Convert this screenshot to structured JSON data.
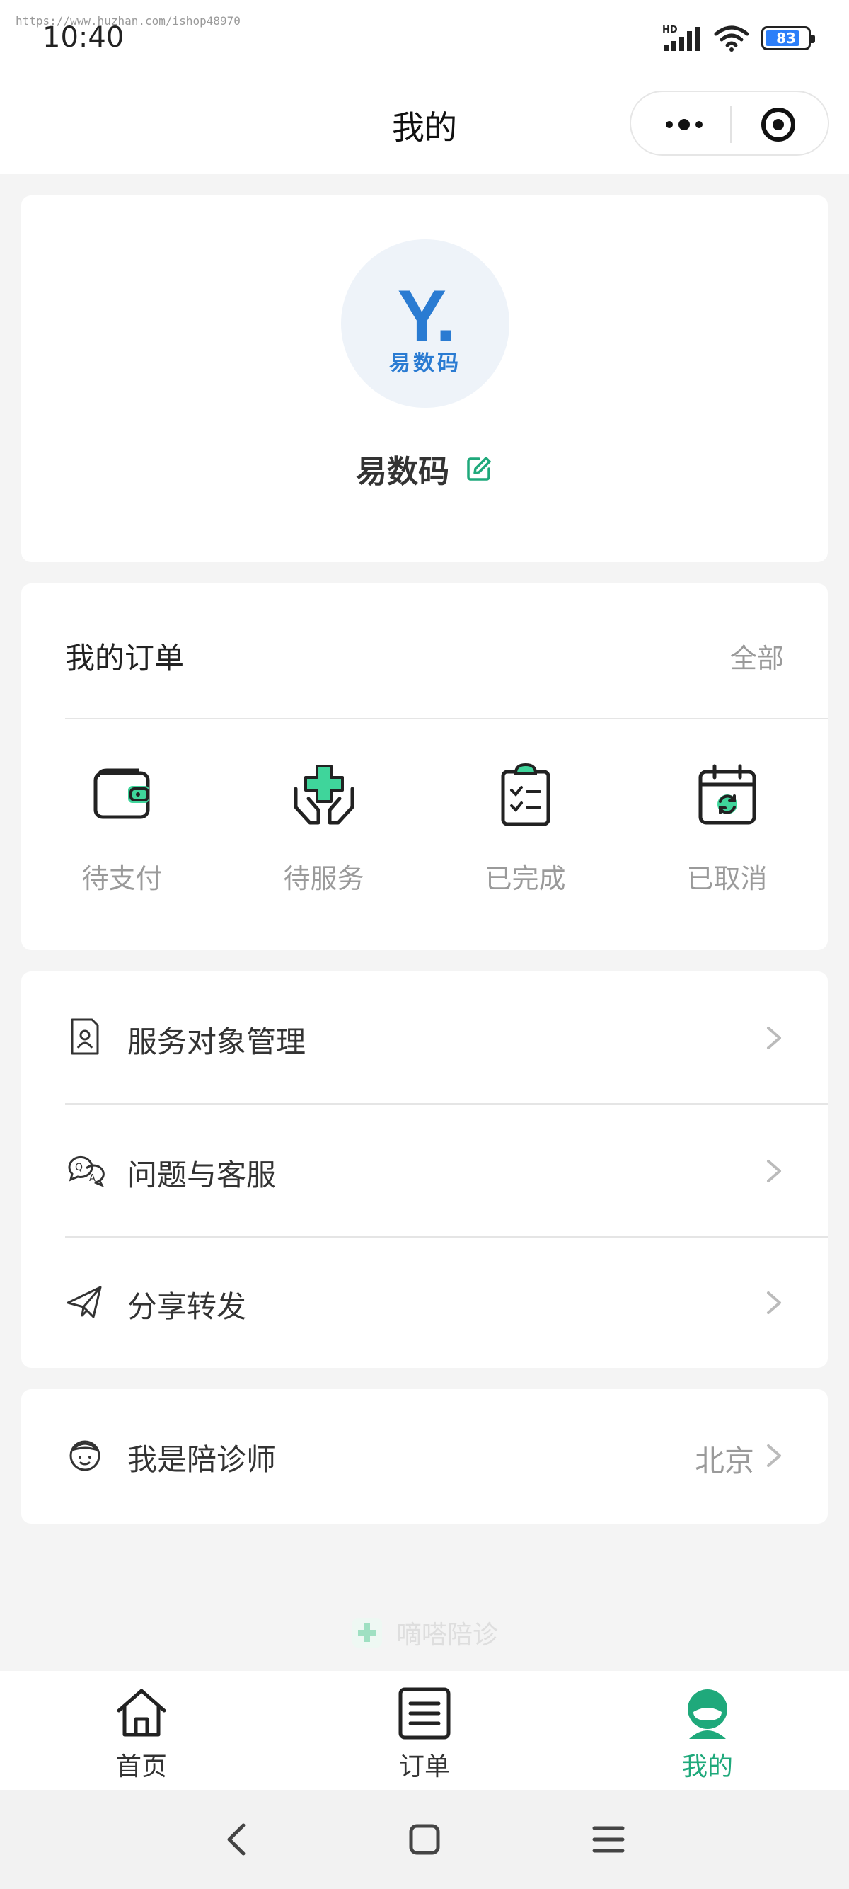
{
  "status_bar": {
    "watermark": "https://www.huzhan.com/ishop48970",
    "time": "10:40",
    "network_label": "HD",
    "battery_level": "83"
  },
  "nav": {
    "title": "我的"
  },
  "profile": {
    "avatar_letter": "Y.",
    "avatar_text": "易数码",
    "name": "易数码"
  },
  "orders": {
    "title": "我的订单",
    "all_label": "全部",
    "statuses": [
      {
        "label": "待支付"
      },
      {
        "label": "待服务"
      },
      {
        "label": "已完成"
      },
      {
        "label": "已取消"
      }
    ]
  },
  "menu": {
    "items": [
      {
        "label": "服务对象管理"
      },
      {
        "label": "问题与客服"
      },
      {
        "label": "分享转发"
      }
    ]
  },
  "doctor": {
    "label": "我是陪诊师",
    "city": "北京"
  },
  "footer": {
    "brand": "嘀嗒陪诊"
  },
  "tabbar": {
    "items": [
      {
        "label": "首页"
      },
      {
        "label": "订单"
      },
      {
        "label": "我的"
      }
    ],
    "active_color": "#1fa97b"
  },
  "colors": {
    "accent": "#1fa97b",
    "accent_light": "#3fd59b",
    "logo_blue": "#2a7bd2"
  }
}
